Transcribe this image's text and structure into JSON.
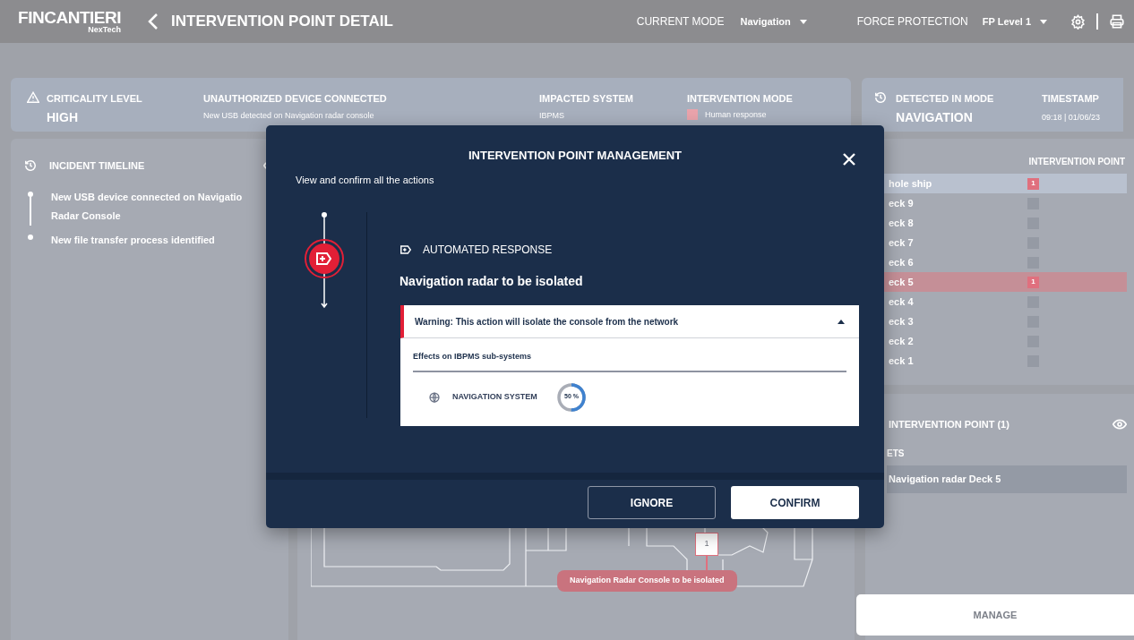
{
  "header": {
    "logo": {
      "name": "FINCANTIERI",
      "sub": "NexTech"
    },
    "title": "INTERVENTION POINT DETAIL",
    "current_mode": {
      "label": "CURRENT MODE",
      "value": "Navigation"
    },
    "force_protection": {
      "label": "FORCE PROTECTION",
      "value": "FP Level 1"
    }
  },
  "summary": {
    "criticality": {
      "label": "CRITICALITY LEVEL",
      "value": "HIGH"
    },
    "event": {
      "title": "UNAUTHORIZED DEVICE CONNECTED",
      "description": "New USB detected on Navigation radar console"
    },
    "impacted_system": {
      "label": "IMPACTED SYSTEM",
      "value": "IBPMS"
    },
    "intervention_mode": {
      "label": "INTERVENTION MODE",
      "value": "Human response",
      "color": "#e9a3ab"
    }
  },
  "detection": {
    "mode": {
      "label": "DETECTED IN MODE",
      "value": "NAVIGATION"
    },
    "timestamp": {
      "label": "TIMESTAMP",
      "value": "09:18 | 01/06/23"
    }
  },
  "timeline": {
    "title": "INCIDENT TIMELINE",
    "events": [
      {
        "lines": [
          "New USB device connected on Navigatio",
          "Radar Console"
        ]
      },
      {
        "lines": [
          "New file transfer process identified"
        ]
      }
    ]
  },
  "map": {
    "marker": "1",
    "label": "Navigation Radar Console to be isolated"
  },
  "decks": {
    "column": "INTERVENTION POINT",
    "rows": [
      {
        "name": "hole ship",
        "kind": "total",
        "count": "1",
        "selected": false
      },
      {
        "name": "eck 9",
        "kind": "deck",
        "selected": false
      },
      {
        "name": "eck 8",
        "kind": "deck",
        "selected": false
      },
      {
        "name": "eck 7",
        "kind": "deck",
        "selected": false
      },
      {
        "name": "eck 6",
        "kind": "deck",
        "selected": false
      },
      {
        "name": "eck 5",
        "kind": "deck",
        "count": "1",
        "selected": true
      },
      {
        "name": "eck 4",
        "kind": "deck",
        "selected": false
      },
      {
        "name": "eck 3",
        "kind": "deck",
        "selected": false
      },
      {
        "name": "eck 2",
        "kind": "deck",
        "selected": false
      },
      {
        "name": "eck 1",
        "kind": "deck",
        "selected": false
      }
    ]
  },
  "intervention_points": {
    "title": "INTERVENTION POINT (1)",
    "section": "ETS",
    "items": [
      "Navigation radar Deck 5"
    ]
  },
  "manage_button": "MANAGE",
  "modal": {
    "title": "INTERVENTION POINT MANAGEMENT",
    "subtitle": "View and confirm all the actions",
    "action": {
      "type": "AUTOMATED RESPONSE",
      "title": "Navigation radar to be isolated",
      "warning": "Warning: This action will isolate the console from the network",
      "expanded": true,
      "effects_title": "Effects on IBPMS sub-systems",
      "effects": [
        {
          "name": "NAVIGATION SYSTEM",
          "reading": "50 %",
          "level": 0.5
        }
      ]
    },
    "buttons": [
      {
        "label": "IGNORE",
        "kind": "secondary"
      },
      {
        "label": "CONFIRM",
        "kind": "primary"
      }
    ]
  }
}
